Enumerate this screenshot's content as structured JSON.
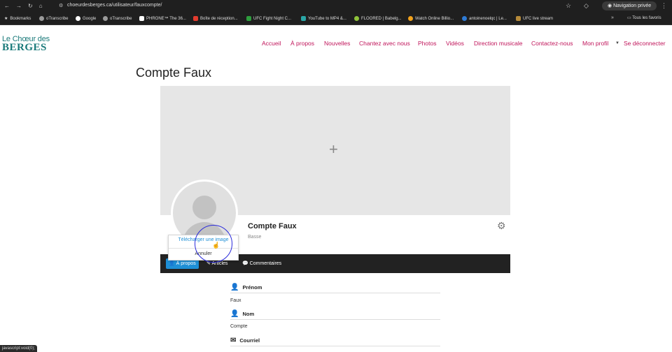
{
  "browser": {
    "url": "choeurdesberges.ca/utilisateur/fauxcompte/",
    "private_label": "Navigation privée",
    "bookmarks": [
      {
        "label": "Bookmarks",
        "color": "#cccccc"
      },
      {
        "label": "oTranscribe",
        "color": "#9a9a9a"
      },
      {
        "label": "Google",
        "color": "#ffffff"
      },
      {
        "label": "oTranscribe",
        "color": "#9a9a9a"
      },
      {
        "label": "PHRONE™ The 36...",
        "color": "#ffffff"
      },
      {
        "label": "Boîte de réception...",
        "color": "#e33b2e"
      },
      {
        "label": "UFC Fight Night C...",
        "color": "#2e9e3e"
      },
      {
        "label": "YouTube to MP4 &...",
        "color": "#2aa6a6"
      },
      {
        "label": "FLOORED | Babelg...",
        "color": "#8fc33a"
      },
      {
        "label": "Watch Online Billio...",
        "color": "#f2a21c"
      },
      {
        "label": "antoinenoelqc | Le...",
        "color": "#2e7bd6"
      },
      {
        "label": "UFC live stream",
        "color": "#b58a3a"
      }
    ],
    "all_bookmarks_label": "Tous les favoris",
    "status_tip": "javascript:void(0);"
  },
  "site": {
    "logo_line1": "Le Chœur des",
    "logo_line2": "BERGES",
    "nav": [
      "Accueil",
      "À propos",
      "Nouvelles",
      "Chantez avec nous",
      "Photos",
      "Vidéos",
      "Direction musicale",
      "Contactez-nous",
      "Mon profil",
      "Se déconnecter"
    ],
    "accent_color": "#c0145a"
  },
  "page": {
    "title": "Compte Faux"
  },
  "profile": {
    "name": "Compte Faux",
    "voice": "Basse",
    "tabs": [
      "À propos",
      "Articles",
      "Commentaires"
    ],
    "active_tab": "À propos",
    "popup": {
      "upload_label": "Télécharger une image",
      "cancel_label": "Annuler"
    },
    "fields": [
      {
        "label": "Prénom",
        "value": "Faux",
        "icon": "user-icon"
      },
      {
        "label": "Nom",
        "value": "Compte",
        "icon": "user-icon"
      },
      {
        "label": "Courriel",
        "value": "",
        "icon": "envelope-icon"
      }
    ]
  }
}
